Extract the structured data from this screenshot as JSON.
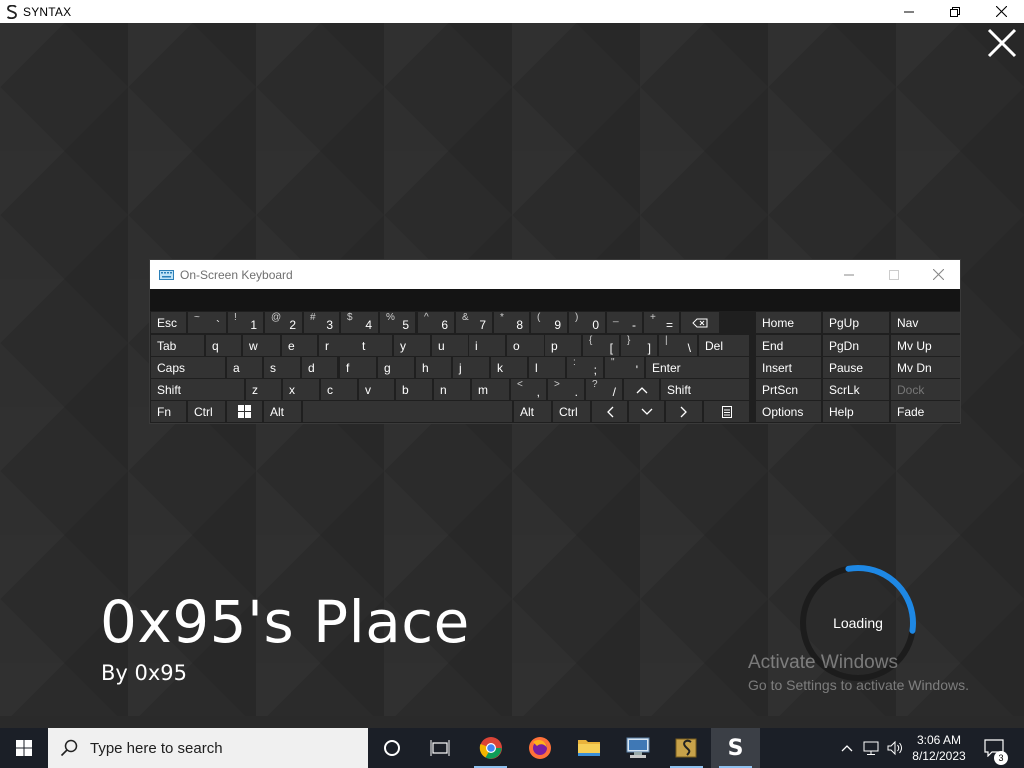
{
  "window": {
    "title": "SYNTAX",
    "icon": "syntax-logo-icon",
    "controls": [
      "minimize-icon",
      "maximize-icon",
      "close-icon"
    ]
  },
  "game": {
    "place_title": "0x95's Place",
    "author": "By 0x95",
    "loading_label": "Loading",
    "loading_progress": 0.3,
    "accent_color": "#1e88e5"
  },
  "watermark": {
    "line1": "Activate Windows",
    "line2": "Go to Settings to activate Windows."
  },
  "osk": {
    "title": "On-Screen Keyboard",
    "rows": {
      "row1": [
        {
          "p": "Esc"
        },
        {
          "s": "~",
          "p": "`"
        },
        {
          "s": "!",
          "p": "1"
        },
        {
          "s": "@",
          "p": "2"
        },
        {
          "s": "#",
          "p": "3"
        },
        {
          "s": "$",
          "p": "4"
        },
        {
          "s": "%",
          "p": "5"
        },
        {
          "s": "^",
          "p": "6"
        },
        {
          "s": "&",
          "p": "7"
        },
        {
          "s": "*",
          "p": "8"
        },
        {
          "s": "(",
          "p": "9"
        },
        {
          "s": ")",
          "p": "0"
        },
        {
          "s": "_",
          "p": "-"
        },
        {
          "s": "+",
          "p": "="
        }
      ],
      "row2": [
        {
          "p": "Tab"
        },
        {
          "p": "q"
        },
        {
          "p": "w"
        },
        {
          "p": "e"
        },
        {
          "p": "r"
        },
        {
          "p": "t"
        },
        {
          "p": "y"
        },
        {
          "p": "u"
        },
        {
          "p": "i"
        },
        {
          "p": "o"
        },
        {
          "p": "p"
        },
        {
          "s": "{",
          "p": "["
        },
        {
          "s": "}",
          "p": "]"
        },
        {
          "s": "|",
          "p": "\\"
        },
        {
          "p": "Del"
        }
      ],
      "row3": [
        {
          "p": "Caps"
        },
        {
          "p": "a"
        },
        {
          "p": "s"
        },
        {
          "p": "d"
        },
        {
          "p": "f"
        },
        {
          "p": "g"
        },
        {
          "p": "h"
        },
        {
          "p": "j"
        },
        {
          "p": "k"
        },
        {
          "p": "l"
        },
        {
          "s": ":",
          "p": ";"
        },
        {
          "s": "\"",
          "p": "'"
        },
        {
          "p": "Enter"
        }
      ],
      "row4": [
        {
          "p": "Shift"
        },
        {
          "p": "z"
        },
        {
          "p": "x"
        },
        {
          "p": "c"
        },
        {
          "p": "v"
        },
        {
          "p": "b"
        },
        {
          "p": "n"
        },
        {
          "p": "m"
        },
        {
          "s": "<",
          "p": ","
        },
        {
          "s": ">",
          "p": "."
        },
        {
          "s": "?",
          "p": "/"
        },
        {
          "p": ""
        },
        {
          "p": "Shift"
        }
      ],
      "row5": [
        {
          "p": "Fn"
        },
        {
          "p": "Ctrl"
        },
        {
          "p": ""
        },
        {
          "p": "Alt"
        },
        {
          "p": ""
        },
        {
          "p": "Alt"
        },
        {
          "p": "Ctrl"
        },
        {
          "p": ""
        },
        {
          "p": ""
        },
        {
          "p": ""
        },
        {
          "p": ""
        }
      ],
      "nav": [
        [
          "Home",
          "PgUp",
          "Nav"
        ],
        [
          "End",
          "PgDn",
          "Mv Up"
        ],
        [
          "Insert",
          "Pause",
          "Mv Dn"
        ],
        [
          "PrtScn",
          "ScrLk",
          "Dock"
        ],
        [
          "Options",
          "Help",
          "Fade"
        ]
      ]
    }
  },
  "taskbar": {
    "search_placeholder": "Type here to search",
    "apps": [
      "cortana-icon",
      "task-view-icon",
      "chrome-icon",
      "firefox-icon",
      "file-explorer-icon",
      "network-computer-icon",
      "syntax-studio-icon",
      "syntax-app-icon"
    ],
    "time": "3:06 AM",
    "date": "8/12/2023",
    "notification_count": "3"
  }
}
